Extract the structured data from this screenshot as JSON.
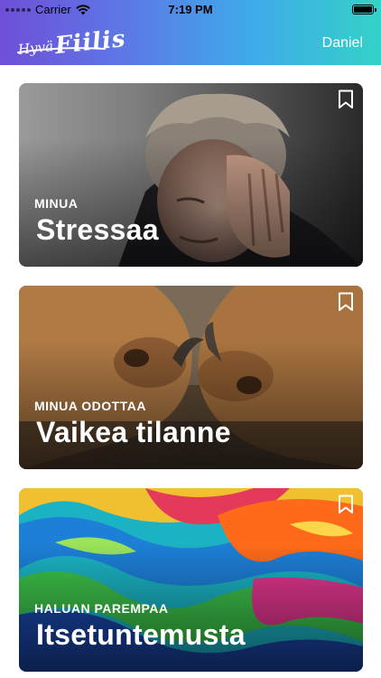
{
  "status_bar": {
    "carrier": "Carrier",
    "time": "7:19 PM"
  },
  "header": {
    "logo_word1": "Hyvä",
    "logo_word2": "Fiilis",
    "username": "Daniel"
  },
  "cards": [
    {
      "kicker": "MINUA",
      "title": "Stressaa",
      "icon": "bookmark-icon"
    },
    {
      "kicker": "MINUA ODOTTAA",
      "title": "Vaikea tilanne",
      "icon": "bookmark-icon"
    },
    {
      "kicker": "HALUAN PAREMPAA",
      "title": "Itsetuntemusta",
      "icon": "bookmark-icon"
    }
  ],
  "colors": {
    "header_gradient": [
      "#6f4fd8",
      "#3fa9ea",
      "#34d2c9"
    ],
    "text_on_image": "#ffffff"
  }
}
